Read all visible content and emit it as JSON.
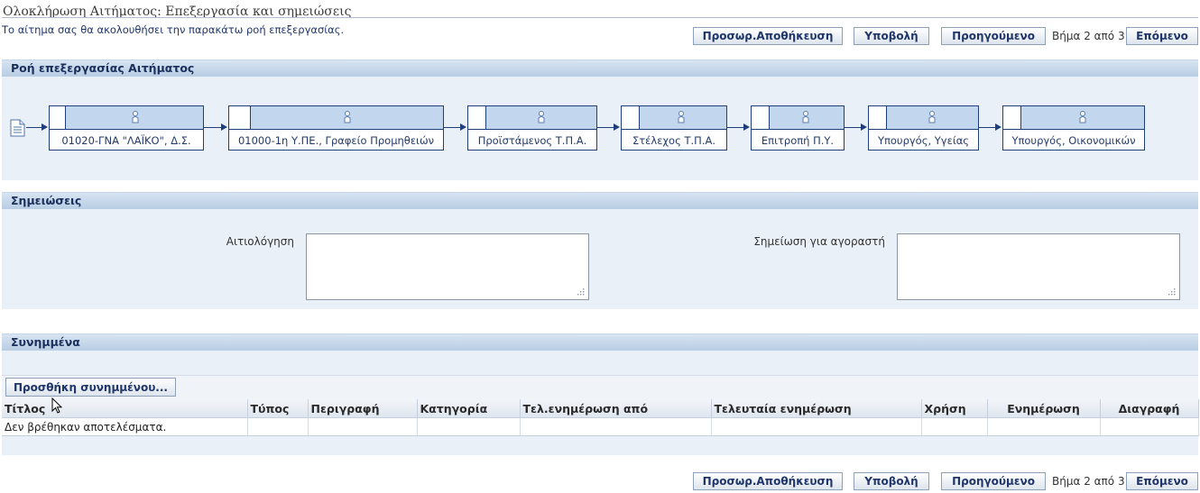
{
  "page": {
    "title": "Ολοκλήρωση Αιτήματος: Επεξεργασία και σημειώσεις",
    "instruction": "Το αίτημα σας θα ακολουθήσει την παρακάτω ροή επεξεργασίας."
  },
  "nav": {
    "save_draft": "Προσωρ.Αποθήκευση",
    "submit": "Υποβολή",
    "previous": "Προηγούμενο",
    "step": "Βήμα 2 από 3",
    "next": "Επόμενο"
  },
  "flow": {
    "header": "Ροή επεξεργασίας Αιτήματος",
    "start_icon": "document-icon",
    "node_icon": "person-icon",
    "nodes": [
      "01020-ΓΝΑ \"ΛΑΪΚΟ\", Δ.Σ.",
      "01000-1η Υ.ΠΕ., Γραφείο Προμηθειών",
      "Προϊστάμενος Τ.Π.Α.",
      "Στέλεχος Τ.Π.Α.",
      "Επιτροπή Π.Υ.",
      "Υπουργός, Υγείας",
      "Υπουργός, Οικονομικών"
    ]
  },
  "notes": {
    "header": "Σημειώσεις",
    "justification_label": "Αιτιολόγηση",
    "justification_value": "",
    "buyer_note_label": "Σημείωση για αγοραστή",
    "buyer_note_value": ""
  },
  "attachments": {
    "header": "Συνημμένα",
    "add_button": "Προσθήκη συνημμένου...",
    "columns": [
      "Τίτλος",
      "Τύπος",
      "Περιγραφή",
      "Κατηγορία",
      "Τελ.ενημέρωση από",
      "Τελευταία ενημέρωση",
      "Χρήση",
      "Ενημέρωση",
      "Διαγραφή"
    ],
    "empty_message": "Δεν βρέθηκαν αποτελέσματα."
  },
  "colors": {
    "accent": "#20366b",
    "section_header": "#c5d7ea",
    "section_body": "#eaf0f7",
    "flow_node": "#c2d6ee"
  }
}
